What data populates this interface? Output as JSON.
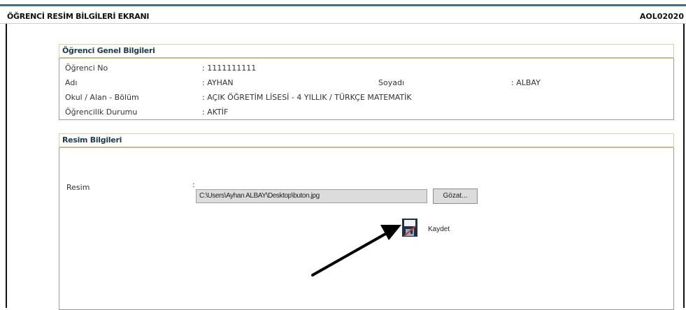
{
  "header": {
    "title": "ÖĞRENCİ RESİM BİLGİLERİ EKRANI",
    "code": "AOL02020"
  },
  "general": {
    "heading": "Öğrenci Genel Bilgileri",
    "rows": [
      {
        "label": "Öğrenci No",
        "value": ": 1111111111"
      },
      {
        "label": "Adı",
        "value": ": AYHAN",
        "label2": "Soyadı",
        "value2": ": ALBAY"
      },
      {
        "label": "Okul / Alan - Bölüm",
        "value": ": AÇIK ÖĞRETİM LİSESİ - 4 YILLIK / TÜRKÇE MATEMATİK"
      },
      {
        "label": "Öğrencilik Durumu",
        "value": ": AKTİF"
      }
    ]
  },
  "photo": {
    "heading": "Resim Bilgileri",
    "label": "Resim",
    "colon": ":",
    "file_value": "C:\\Users\\Ayhan ALBAY\\Desktop\\buton.jpg",
    "browse_label": "Gözat...",
    "save_label": "Kaydet"
  },
  "colors": {
    "topline": "#3f6f80",
    "section_border": "#d9cfa0",
    "heading_text": "#1e3a4a"
  }
}
